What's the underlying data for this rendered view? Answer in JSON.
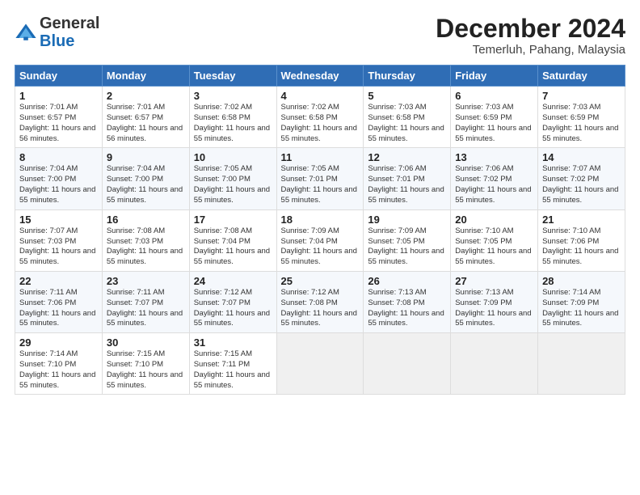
{
  "logo": {
    "general": "General",
    "blue": "Blue"
  },
  "header": {
    "month": "December 2024",
    "location": "Temerluh, Pahang, Malaysia"
  },
  "days_of_week": [
    "Sunday",
    "Monday",
    "Tuesday",
    "Wednesday",
    "Thursday",
    "Friday",
    "Saturday"
  ],
  "weeks": [
    [
      {
        "day": "1",
        "sunrise": "7:01 AM",
        "sunset": "6:57 PM",
        "daylight": "11 hours and 56 minutes."
      },
      {
        "day": "2",
        "sunrise": "7:01 AM",
        "sunset": "6:57 PM",
        "daylight": "11 hours and 56 minutes."
      },
      {
        "day": "3",
        "sunrise": "7:02 AM",
        "sunset": "6:58 PM",
        "daylight": "11 hours and 55 minutes."
      },
      {
        "day": "4",
        "sunrise": "7:02 AM",
        "sunset": "6:58 PM",
        "daylight": "11 hours and 55 minutes."
      },
      {
        "day": "5",
        "sunrise": "7:03 AM",
        "sunset": "6:58 PM",
        "daylight": "11 hours and 55 minutes."
      },
      {
        "day": "6",
        "sunrise": "7:03 AM",
        "sunset": "6:59 PM",
        "daylight": "11 hours and 55 minutes."
      },
      {
        "day": "7",
        "sunrise": "7:03 AM",
        "sunset": "6:59 PM",
        "daylight": "11 hours and 55 minutes."
      }
    ],
    [
      {
        "day": "8",
        "sunrise": "7:04 AM",
        "sunset": "7:00 PM",
        "daylight": "11 hours and 55 minutes."
      },
      {
        "day": "9",
        "sunrise": "7:04 AM",
        "sunset": "7:00 PM",
        "daylight": "11 hours and 55 minutes."
      },
      {
        "day": "10",
        "sunrise": "7:05 AM",
        "sunset": "7:00 PM",
        "daylight": "11 hours and 55 minutes."
      },
      {
        "day": "11",
        "sunrise": "7:05 AM",
        "sunset": "7:01 PM",
        "daylight": "11 hours and 55 minutes."
      },
      {
        "day": "12",
        "sunrise": "7:06 AM",
        "sunset": "7:01 PM",
        "daylight": "11 hours and 55 minutes."
      },
      {
        "day": "13",
        "sunrise": "7:06 AM",
        "sunset": "7:02 PM",
        "daylight": "11 hours and 55 minutes."
      },
      {
        "day": "14",
        "sunrise": "7:07 AM",
        "sunset": "7:02 PM",
        "daylight": "11 hours and 55 minutes."
      }
    ],
    [
      {
        "day": "15",
        "sunrise": "7:07 AM",
        "sunset": "7:03 PM",
        "daylight": "11 hours and 55 minutes."
      },
      {
        "day": "16",
        "sunrise": "7:08 AM",
        "sunset": "7:03 PM",
        "daylight": "11 hours and 55 minutes."
      },
      {
        "day": "17",
        "sunrise": "7:08 AM",
        "sunset": "7:04 PM",
        "daylight": "11 hours and 55 minutes."
      },
      {
        "day": "18",
        "sunrise": "7:09 AM",
        "sunset": "7:04 PM",
        "daylight": "11 hours and 55 minutes."
      },
      {
        "day": "19",
        "sunrise": "7:09 AM",
        "sunset": "7:05 PM",
        "daylight": "11 hours and 55 minutes."
      },
      {
        "day": "20",
        "sunrise": "7:10 AM",
        "sunset": "7:05 PM",
        "daylight": "11 hours and 55 minutes."
      },
      {
        "day": "21",
        "sunrise": "7:10 AM",
        "sunset": "7:06 PM",
        "daylight": "11 hours and 55 minutes."
      }
    ],
    [
      {
        "day": "22",
        "sunrise": "7:11 AM",
        "sunset": "7:06 PM",
        "daylight": "11 hours and 55 minutes."
      },
      {
        "day": "23",
        "sunrise": "7:11 AM",
        "sunset": "7:07 PM",
        "daylight": "11 hours and 55 minutes."
      },
      {
        "day": "24",
        "sunrise": "7:12 AM",
        "sunset": "7:07 PM",
        "daylight": "11 hours and 55 minutes."
      },
      {
        "day": "25",
        "sunrise": "7:12 AM",
        "sunset": "7:08 PM",
        "daylight": "11 hours and 55 minutes."
      },
      {
        "day": "26",
        "sunrise": "7:13 AM",
        "sunset": "7:08 PM",
        "daylight": "11 hours and 55 minutes."
      },
      {
        "day": "27",
        "sunrise": "7:13 AM",
        "sunset": "7:09 PM",
        "daylight": "11 hours and 55 minutes."
      },
      {
        "day": "28",
        "sunrise": "7:14 AM",
        "sunset": "7:09 PM",
        "daylight": "11 hours and 55 minutes."
      }
    ],
    [
      {
        "day": "29",
        "sunrise": "7:14 AM",
        "sunset": "7:10 PM",
        "daylight": "11 hours and 55 minutes."
      },
      {
        "day": "30",
        "sunrise": "7:15 AM",
        "sunset": "7:10 PM",
        "daylight": "11 hours and 55 minutes."
      },
      {
        "day": "31",
        "sunrise": "7:15 AM",
        "sunset": "7:11 PM",
        "daylight": "11 hours and 55 minutes."
      },
      null,
      null,
      null,
      null
    ]
  ],
  "labels": {
    "sunrise": "Sunrise:",
    "sunset": "Sunset:",
    "daylight": "Daylight:"
  }
}
